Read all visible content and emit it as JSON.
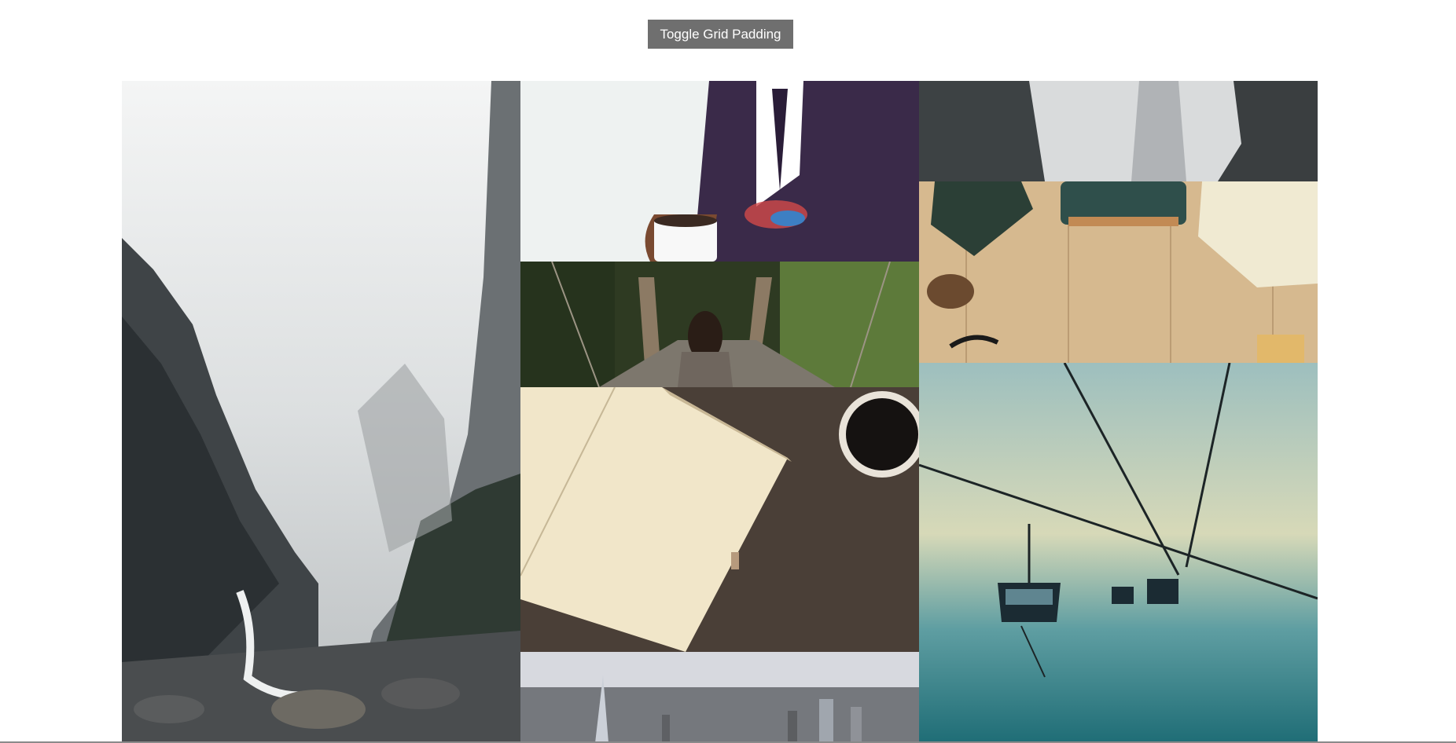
{
  "toolbar": {
    "toggle_label": "Toggle Grid Padding"
  },
  "gallery": {
    "tiles": [
      {
        "name": "photo-misty-canyon-waterfall",
        "icon": "image-icon"
      },
      {
        "name": "photo-suit-coffee-cup",
        "icon": "image-icon"
      },
      {
        "name": "photo-foggy-cliffs",
        "icon": "image-icon"
      },
      {
        "name": "photo-typewriter-desk",
        "icon": "image-icon"
      },
      {
        "name": "photo-woman-on-bridge",
        "icon": "image-icon"
      },
      {
        "name": "photo-notebook-coffee",
        "icon": "image-icon"
      },
      {
        "name": "photo-cable-car",
        "icon": "image-icon"
      },
      {
        "name": "photo-city-skyline",
        "icon": "image-icon"
      }
    ]
  },
  "colors": {
    "button_bg": "#6f6f6f",
    "page_bg": "#ffffff"
  }
}
